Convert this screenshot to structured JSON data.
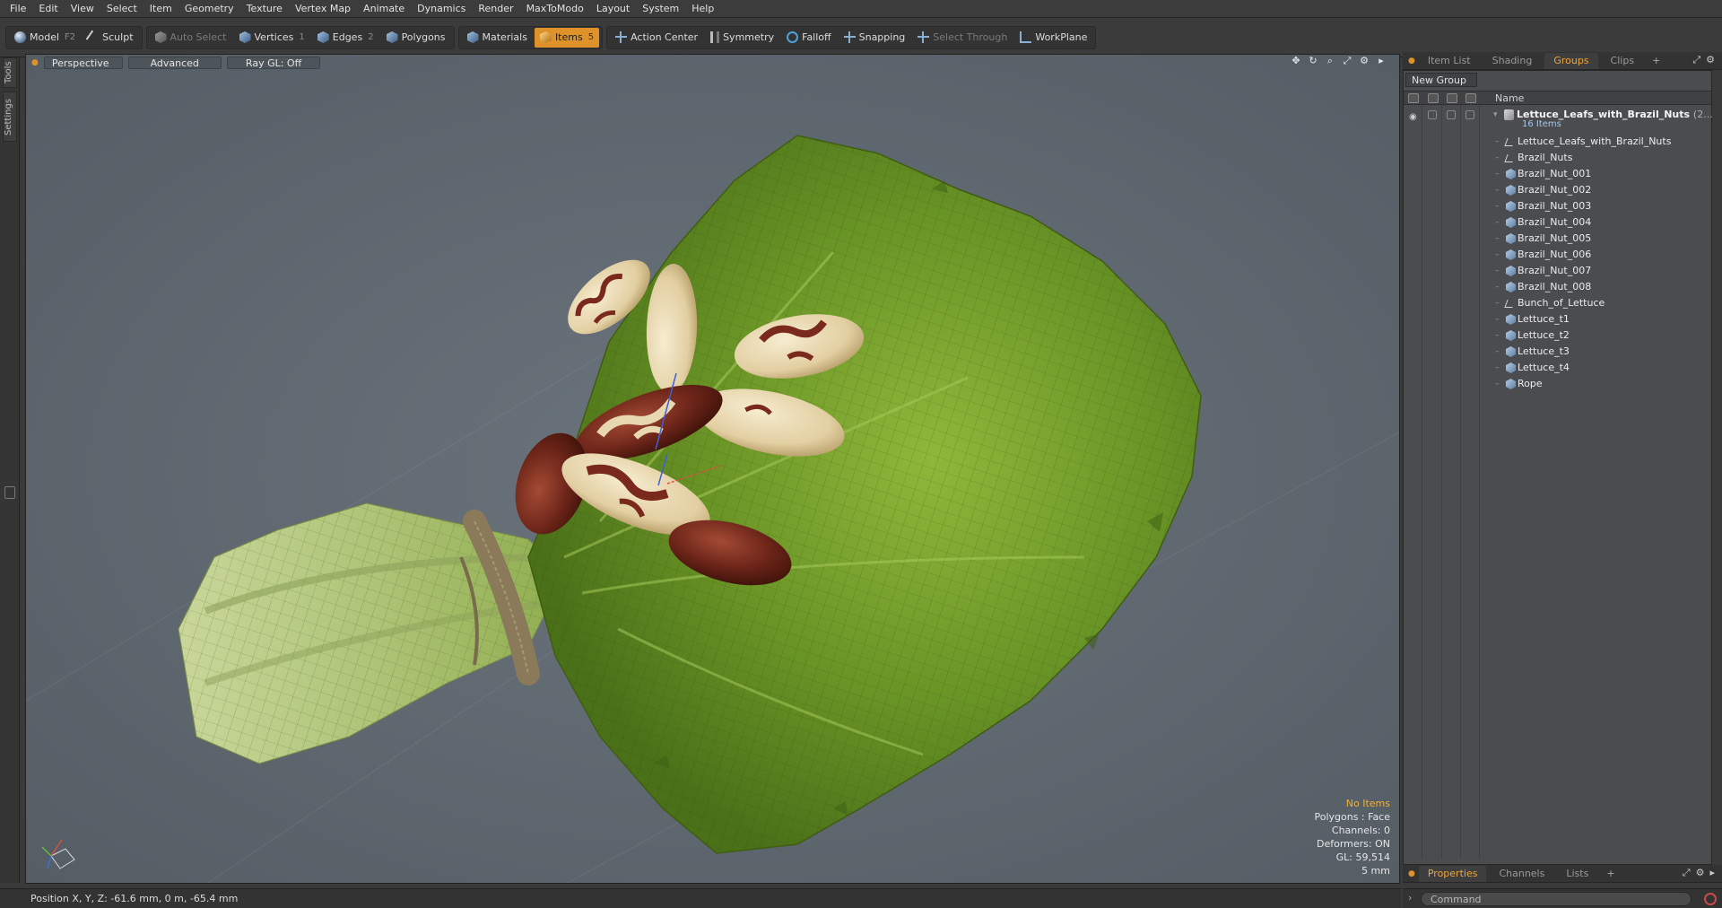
{
  "menu": [
    "File",
    "Edit",
    "View",
    "Select",
    "Item",
    "Geometry",
    "Texture",
    "Vertex Map",
    "Animate",
    "Dynamics",
    "Render",
    "MaxToModo",
    "Layout",
    "System",
    "Help"
  ],
  "toolbar": {
    "model": "Model",
    "model_key": "F2",
    "sculpt": "Sculpt",
    "auto_select": "Auto Select",
    "vertices": "Vertices",
    "vertices_key": "1",
    "edges": "Edges",
    "edges_key": "2",
    "polygons": "Polygons",
    "materials": "Materials",
    "items": "Items",
    "items_key": "5",
    "action_center": "Action Center",
    "symmetry": "Symmetry",
    "falloff": "Falloff",
    "snapping": "Snapping",
    "select_through": "Select Through",
    "workplane": "WorkPlane"
  },
  "left_tabs": [
    "Tools",
    "Settings"
  ],
  "viewport": {
    "view_mode": "Perspective",
    "shading": "Advanced",
    "raygl": "Ray GL: Off",
    "hud": {
      "selection": "No Items",
      "polygons": "Polygons : Face",
      "channels": "Channels: 0",
      "deformers": "Deformers: ON",
      "gl": "GL: 59,514",
      "scale": "5 mm"
    }
  },
  "top_tabs": {
    "item_list": "Item List",
    "shading": "Shading",
    "groups": "Groups",
    "clips": "Clips",
    "plus": "+"
  },
  "groups": {
    "new_group": "New Group",
    "name_header": "Name",
    "root": {
      "name": "Lettuce_Leafs_with_Brazil_Nuts",
      "count": "(2...",
      "sub": "16 Items"
    },
    "items": [
      {
        "name": "Lettuce_Leafs_with_Brazil_Nuts",
        "icon": "locator-icon"
      },
      {
        "name": "Brazil_Nuts",
        "icon": "locator-icon"
      },
      {
        "name": "Brazil_Nut_001",
        "icon": "mesh-icon"
      },
      {
        "name": "Brazil_Nut_002",
        "icon": "mesh-icon"
      },
      {
        "name": "Brazil_Nut_003",
        "icon": "mesh-icon"
      },
      {
        "name": "Brazil_Nut_004",
        "icon": "mesh-icon"
      },
      {
        "name": "Brazil_Nut_005",
        "icon": "mesh-icon"
      },
      {
        "name": "Brazil_Nut_006",
        "icon": "mesh-icon"
      },
      {
        "name": "Brazil_Nut_007",
        "icon": "mesh-icon"
      },
      {
        "name": "Brazil_Nut_008",
        "icon": "mesh-icon"
      },
      {
        "name": "Bunch_of_Lettuce",
        "icon": "locator-icon"
      },
      {
        "name": "Lettuce_t1",
        "icon": "mesh-icon"
      },
      {
        "name": "Lettuce_t2",
        "icon": "mesh-icon"
      },
      {
        "name": "Lettuce_t3",
        "icon": "mesh-icon"
      },
      {
        "name": "Lettuce_t4",
        "icon": "mesh-icon"
      },
      {
        "name": "Rope",
        "icon": "mesh-icon"
      }
    ]
  },
  "bottom_tabs": {
    "properties": "Properties",
    "channels": "Channels",
    "lists": "Lists",
    "plus": "+"
  },
  "status": {
    "position": "Position X, Y, Z:   -61.6 mm, 0 m, -65.4 mm"
  },
  "command": {
    "placeholder": "Command"
  },
  "colors": {
    "accent": "#e0922a",
    "viewport_bg": "#5d666f",
    "lettuce": "#6f9a2a",
    "nut_shell": "#6b2418",
    "nut_flesh": "#e8d8b0"
  }
}
